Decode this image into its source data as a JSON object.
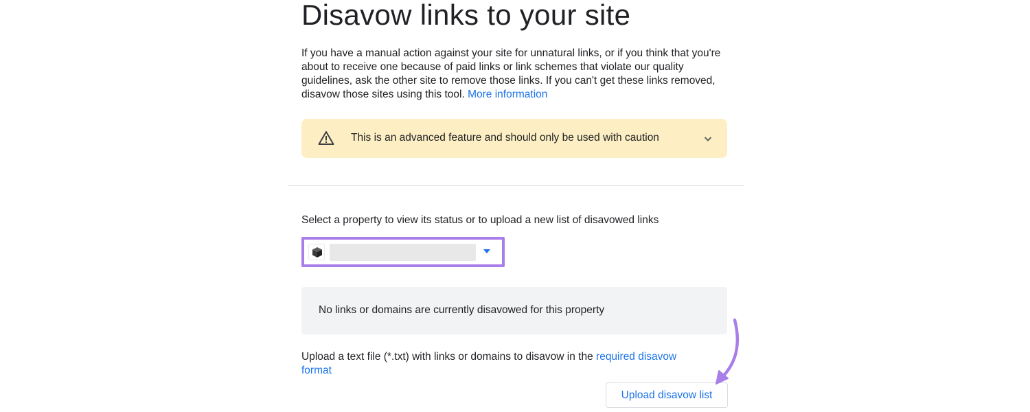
{
  "page": {
    "title": "Disavow links to your site",
    "intro_lines": [
      "If you have a manual action against your site for unnatural links, or if you think that you're",
      "about to receive one because of paid links or link schemes that violate our quality",
      "guidelines, ask the other site to remove those links. If you can't get these links removed,",
      "disavow those sites using this tool."
    ],
    "more_info_link": "More information"
  },
  "caution": {
    "text": "This is an advanced feature and should only be used with caution",
    "icon": "warning-triangle-icon",
    "expand_icon": "chevron-down-icon",
    "background": "#fdefc3"
  },
  "property": {
    "label": "Select a property to view its status or to upload a new list of disavowed links",
    "icon": "property-cube-icon",
    "highlight_color": "#a87ee8"
  },
  "status": {
    "text": "No links or domains are currently disavowed for this property"
  },
  "upload": {
    "help_prefix": "Upload a text file (*.txt) with links or domains to disavow in the ",
    "help_link_line1": "required disavow",
    "help_link_line2": "format",
    "button_label": "Upload disavow list"
  },
  "colors": {
    "link": "#1a73e8",
    "annotation": "#a87ee8"
  }
}
